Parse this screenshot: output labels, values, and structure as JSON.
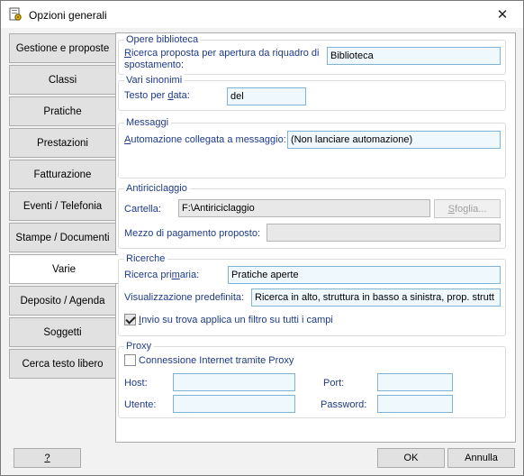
{
  "window": {
    "title": "Opzioni generali",
    "close_glyph": "✕"
  },
  "tabs": [
    {
      "label": "Gestione e proposte"
    },
    {
      "label": "Classi"
    },
    {
      "label": "Pratiche"
    },
    {
      "label": "Prestazioni"
    },
    {
      "label": "Fatturazione"
    },
    {
      "label": "Eventi / Telefonia"
    },
    {
      "label": "Stampe / Documenti"
    },
    {
      "label": "Varie",
      "active": true
    },
    {
      "label": "Deposito / Agenda"
    },
    {
      "label": "Soggetti"
    },
    {
      "label": "Cerca testo libero"
    }
  ],
  "opere_biblioteca": {
    "title": "Opere biblioteca",
    "label_line1_u": "R",
    "label_line1": "icerca proposta per apertura da riquadro di",
    "label_line2": "spostamento:",
    "value": "Biblioteca"
  },
  "vari_sinonimi": {
    "title": "Vari sinonimi",
    "label_pre": "Testo per ",
    "label_u": "d",
    "label_post": "ata:",
    "value": "del"
  },
  "messaggi": {
    "title": "Messaggi",
    "label_u": "A",
    "label_post": "utomazione collegata a messaggio:",
    "value": "(Non lanciare automazione)"
  },
  "antiriciclaggio": {
    "title": "Antiriciclaggio",
    "cartella_label": "Cartella:",
    "cartella_value": "F:\\Antiriciclaggio",
    "browse_pre": "",
    "browse_u": "S",
    "browse_post": "foglia...",
    "mezzo_label": "Mezzo di pagamento proposto:",
    "mezzo_value": ""
  },
  "ricerche": {
    "title": "Ricerche",
    "primaria_pre": "Ricerca pri",
    "primaria_u": "m",
    "primaria_post": "aria:",
    "primaria_value": "Pratiche aperte",
    "vis_label": "Visualizzazione predefinita:",
    "vis_value": "Ricerca in alto, struttura in basso a sinistra, prop. strutt",
    "checkbox_u": "I",
    "checkbox_post": "nvio su trova applica un filtro su tutti i campi",
    "checkbox_checked": true
  },
  "proxy": {
    "title": "Proxy",
    "checkbox_label": "Connessione Internet tramite Proxy",
    "checkbox_checked": false,
    "host_label": "Host:",
    "host_value": "",
    "port_label": "Port:",
    "port_value": "",
    "utente_label": "Utente:",
    "utente_value": "",
    "password_label": "Password:",
    "password_value": ""
  },
  "footer": {
    "help_label": "?",
    "ok_label": "OK",
    "cancel_label": "Annulla"
  },
  "colors": {
    "label_blue": "#1e3a8a",
    "field_border": "#7fb4d8",
    "field_bg": "#eef8fd"
  }
}
